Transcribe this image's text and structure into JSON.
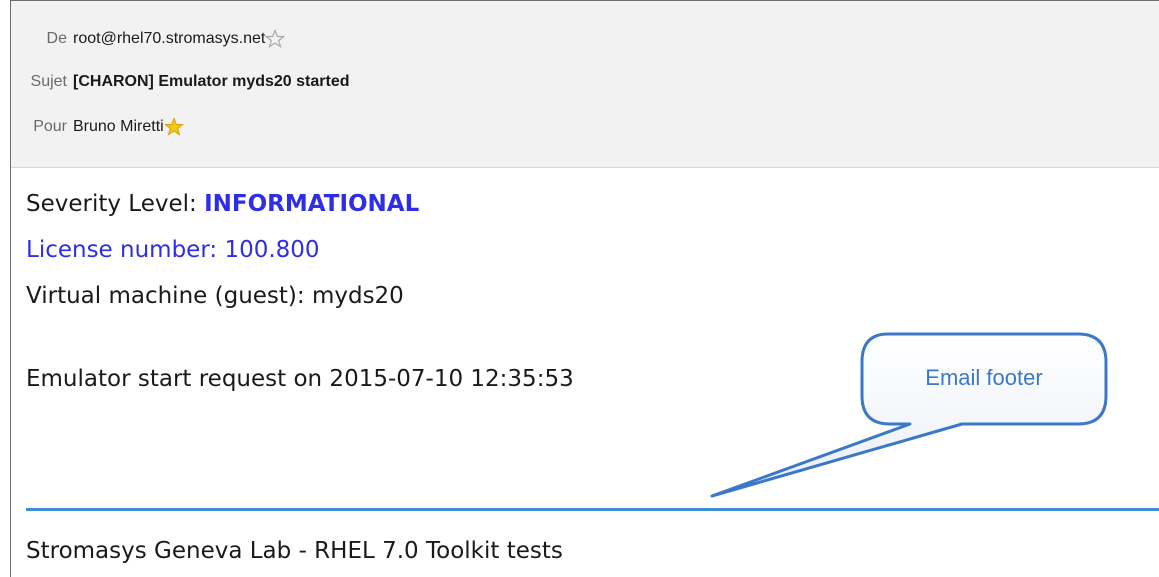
{
  "header": {
    "from": {
      "label": "De",
      "value": "root@rhel70.stromasys.net"
    },
    "subject": {
      "label": "Sujet",
      "value": "[CHARON] Emulator myds20 started"
    },
    "to": {
      "label": "Pour",
      "value": "Bruno Miretti"
    }
  },
  "body": {
    "severity_label": "Severity Level: ",
    "severity_value": "INFORMATIONAL",
    "license": "License number: 100.800",
    "vm": "Virtual machine (guest): myds20",
    "start": "Emulator start request on 2015-07-10 12:35:53",
    "footer": "Stromasys Geneva Lab - RHEL 7.0 Toolkit tests"
  },
  "annotation": {
    "label": "Email footer"
  },
  "colors": {
    "accent_blue": "#2e2ee6",
    "divider": "#3c8fd6",
    "callout_stroke": "#3c78c8",
    "star_gold": "#f5c518"
  }
}
